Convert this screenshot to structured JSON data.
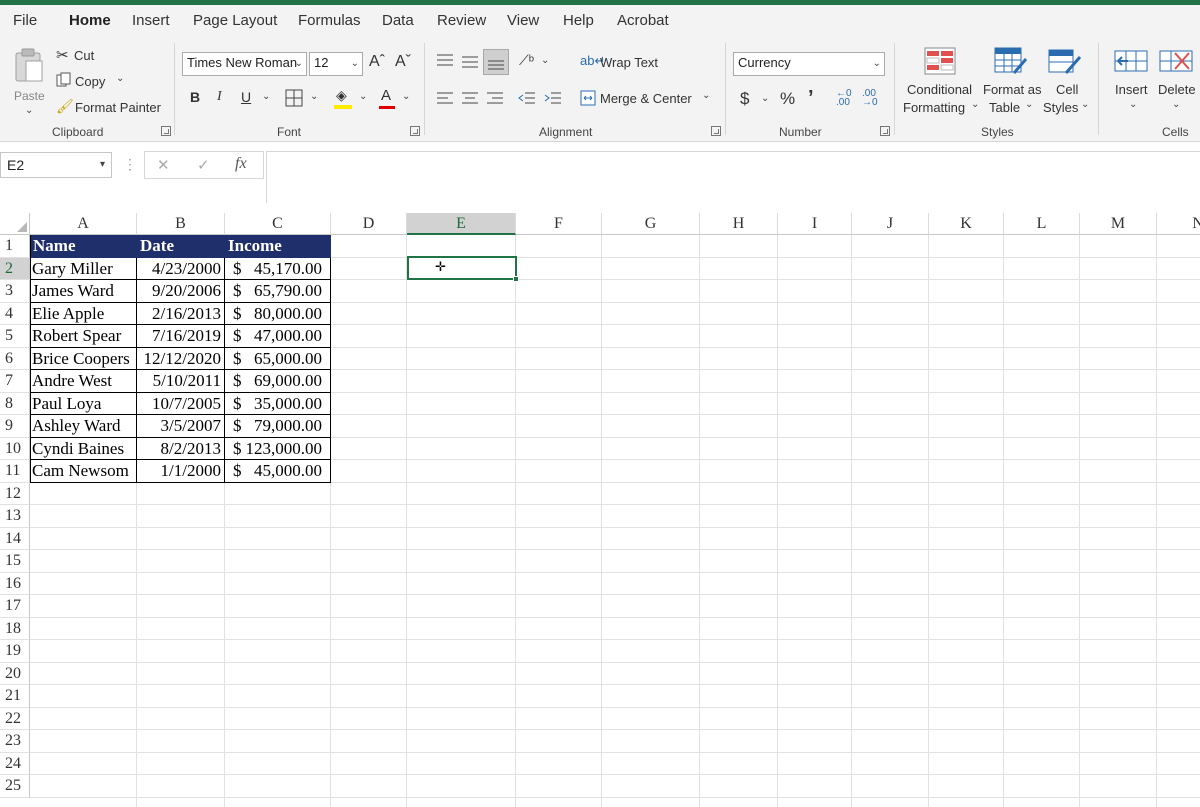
{
  "tabs": [
    "File",
    "Home",
    "Insert",
    "Page Layout",
    "Formulas",
    "Data",
    "Review",
    "View",
    "Help",
    "Acrobat"
  ],
  "clipboard": {
    "paste": "Paste",
    "cut": "Cut",
    "copy": "Copy",
    "format_painter": "Format Painter",
    "label": "Clipboard"
  },
  "font": {
    "name": "Times New Roman",
    "size": "12",
    "bold": "B",
    "italic": "I",
    "underline": "U",
    "grow": "Aˆ",
    "shrink": "Aˇ",
    "color_letter": "A",
    "label": "Font"
  },
  "alignment": {
    "wrap": "Wrap Text",
    "merge": "Merge & Center",
    "label": "Alignment"
  },
  "number": {
    "format": "Currency",
    "dollar": "$",
    "percent": "%",
    "comma": "’",
    "label": "Number"
  },
  "styles": {
    "cond1": "Conditional",
    "cond2": "Formatting",
    "fmt1": "Format as",
    "fmt2": "Table",
    "cell1": "Cell",
    "cell2": "Styles",
    "label": "Styles"
  },
  "cells": {
    "insert": "Insert",
    "delete": "Delete",
    "label": "Cells"
  },
  "formula_bar": {
    "name_box": "E2",
    "fx": "fx",
    "cancel": "✕",
    "enter": "✓",
    "formula": ""
  },
  "columns": [
    "A",
    "B",
    "C",
    "D",
    "E",
    "F",
    "G",
    "H",
    "I",
    "J",
    "K",
    "L",
    "M",
    "N"
  ],
  "selected_column": "E",
  "selected_row": "2",
  "rows": [
    "1",
    "2",
    "3",
    "4",
    "5",
    "6",
    "7",
    "8",
    "9",
    "10",
    "11",
    "12",
    "13",
    "14",
    "15",
    "16",
    "17",
    "18",
    "19",
    "20",
    "21",
    "22",
    "23",
    "24",
    "25"
  ],
  "table": {
    "headers": [
      "Name",
      "Date",
      "Income"
    ],
    "data": [
      {
        "name": "Gary Miller",
        "date": "4/23/2000",
        "cur": "$",
        "amount": "45,170.00"
      },
      {
        "name": "James Ward",
        "date": "9/20/2006",
        "cur": "$",
        "amount": "65,790.00"
      },
      {
        "name": "Elie Apple",
        "date": "2/16/2013",
        "cur": "$",
        "amount": "80,000.00"
      },
      {
        "name": "Robert Spear",
        "date": "7/16/2019",
        "cur": "$",
        "amount": "47,000.00"
      },
      {
        "name": "Brice Coopers",
        "date": "12/12/2020",
        "cur": "$",
        "amount": "65,000.00"
      },
      {
        "name": "Andre West",
        "date": "5/10/2011",
        "cur": "$",
        "amount": "69,000.00"
      },
      {
        "name": "Paul Loya",
        "date": "10/7/2005",
        "cur": "$",
        "amount": "35,000.00"
      },
      {
        "name": "Ashley Ward",
        "date": "3/5/2007",
        "cur": "$",
        "amount": "79,000.00"
      },
      {
        "name": "Cyndi Baines",
        "date": "8/2/2013",
        "cur": "$",
        "amount": "123,000.00"
      },
      {
        "name": "Cam Newsom",
        "date": "1/1/2000",
        "cur": "$",
        "amount": "45,000.00"
      }
    ]
  },
  "colors": {
    "accent": "#217346",
    "table_header": "#1f2f6b"
  }
}
